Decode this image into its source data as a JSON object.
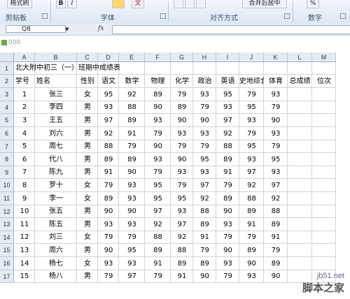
{
  "ribbon": {
    "groups": [
      {
        "label": "剪贴板"
      },
      {
        "label": "字体"
      },
      {
        "label": "对齐方式"
      },
      {
        "label": "数字"
      }
    ],
    "top_buttons": {
      "paste_label": "格式刷",
      "bold": "B",
      "italic": "I",
      "font_color": "文",
      "merge_center": "合并后居中",
      "percent": "%"
    }
  },
  "formula_bar": {
    "name_box": "Q8",
    "fx": "fx",
    "value": ""
  },
  "window": {
    "title": "000"
  },
  "sheet": {
    "columns": [
      "A",
      "B",
      "C",
      "D",
      "E",
      "F",
      "G",
      "H",
      "I",
      "J",
      "K",
      "L",
      "M"
    ],
    "row_numbers": [
      "1",
      "2",
      "3",
      "4",
      "5",
      "6",
      "7",
      "8",
      "9",
      "10",
      "11",
      "12",
      "13",
      "14",
      "15",
      "16",
      "17"
    ],
    "title": "北大附中初三（一）班期中成绩表",
    "headers": [
      "学号",
      "姓名",
      "性别",
      "语文",
      "数学",
      "物理",
      "化学",
      "政治",
      "英语",
      "史地综合",
      "体育",
      "总成绩",
      "位次"
    ],
    "rows": [
      [
        "1",
        "张三",
        "女",
        "95",
        "92",
        "89",
        "79",
        "93",
        "95",
        "79",
        "93"
      ],
      [
        "2",
        "李四",
        "男",
        "93",
        "88",
        "90",
        "89",
        "79",
        "93",
        "95",
        "79"
      ],
      [
        "3",
        "王五",
        "男",
        "97",
        "89",
        "93",
        "90",
        "90",
        "97",
        "93",
        "90"
      ],
      [
        "4",
        "刘六",
        "男",
        "92",
        "91",
        "79",
        "93",
        "93",
        "92",
        "79",
        "93"
      ],
      [
        "5",
        "周七",
        "男",
        "88",
        "79",
        "90",
        "79",
        "79",
        "88",
        "95",
        "79"
      ],
      [
        "6",
        "代八",
        "男",
        "89",
        "89",
        "93",
        "90",
        "95",
        "89",
        "93",
        "95"
      ],
      [
        "7",
        "陈九",
        "男",
        "91",
        "90",
        "79",
        "93",
        "93",
        "91",
        "97",
        "93"
      ],
      [
        "8",
        "罗十",
        "女",
        "79",
        "93",
        "95",
        "79",
        "97",
        "79",
        "92",
        "97"
      ],
      [
        "9",
        "李一",
        "女",
        "89",
        "93",
        "95",
        "95",
        "92",
        "89",
        "88",
        "92"
      ],
      [
        "10",
        "张五",
        "男",
        "90",
        "90",
        "97",
        "93",
        "88",
        "90",
        "89",
        "88"
      ],
      [
        "11",
        "陈五",
        "男",
        "93",
        "93",
        "92",
        "97",
        "89",
        "93",
        "91",
        "89"
      ],
      [
        "12",
        "刘三",
        "女",
        "79",
        "79",
        "88",
        "92",
        "91",
        "79",
        "79",
        "91"
      ],
      [
        "13",
        "周六",
        "男",
        "90",
        "95",
        "89",
        "88",
        "79",
        "90",
        "89",
        "79"
      ],
      [
        "14",
        "杨七",
        "女",
        "93",
        "93",
        "91",
        "89",
        "89",
        "93",
        "90",
        "89"
      ],
      [
        "15",
        "杨八",
        "男",
        "79",
        "97",
        "79",
        "91",
        "90",
        "79",
        "93",
        "90"
      ]
    ]
  },
  "watermark": {
    "url": "jb51.net",
    "name": "脚本之家"
  }
}
